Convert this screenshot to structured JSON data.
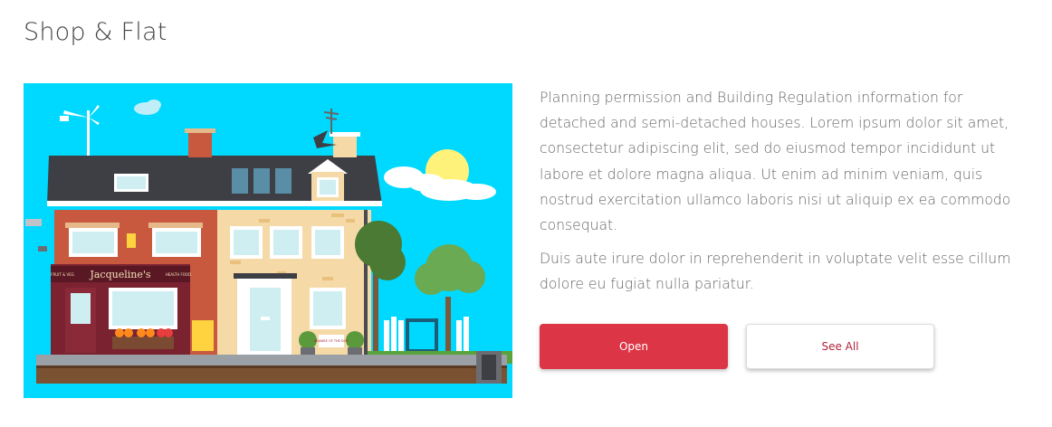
{
  "page": {
    "title": "Shop & Flat"
  },
  "illustration": {
    "shop_sign": "Jacqueline's",
    "shop_sign_left": "FRUIT & VEG",
    "shop_sign_right": "HEALTH FOOD",
    "flat_sign": "BEWARE OF THE DOG"
  },
  "content": {
    "paragraph_1": "Planning permission and Building Regulation information for detached and semi-detached houses. Lorem ipsum dolor sit amet, consectetur adipiscing elit, sed do eiusmod tempor incididunt ut labore et dolore magna aliqua. Ut enim ad minim veniam, quis nostrud exercitation ullamco laboris nisi ut aliquip ex ea commodo consequat.",
    "paragraph_2": "Duis aute irure dolor in reprehenderit in voluptate velit esse cillum dolore eu fugiat nulla pariatur."
  },
  "actions": {
    "open_label": "Open",
    "see_all_label": "See All"
  },
  "colors": {
    "primary_button": "#dc3545",
    "secondary_button_text": "#b0243a",
    "sky": "#00d9ff"
  }
}
